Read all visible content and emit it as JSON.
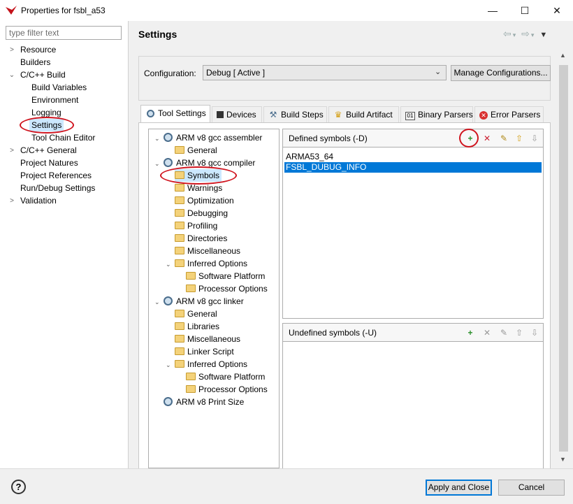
{
  "window": {
    "title": "Properties for fsbl_a53",
    "minimize": "—",
    "maximize": "☐",
    "close": "✕"
  },
  "filter": {
    "placeholder": "type filter text"
  },
  "nav": {
    "items": [
      {
        "label": "Resource"
      },
      {
        "label": "Builders"
      },
      {
        "label": "C/C++ Build"
      },
      {
        "label": "Build Variables"
      },
      {
        "label": "Environment"
      },
      {
        "label": "Logging"
      },
      {
        "label": "Settings"
      },
      {
        "label": "Tool Chain Editor"
      },
      {
        "label": "C/C++ General"
      },
      {
        "label": "Project Natures"
      },
      {
        "label": "Project References"
      },
      {
        "label": "Run/Debug Settings"
      },
      {
        "label": "Validation"
      }
    ]
  },
  "header": {
    "title": "Settings"
  },
  "config": {
    "label": "Configuration:",
    "value": "Debug  [ Active ]",
    "manage_label": "Manage Configurations..."
  },
  "tabs": [
    {
      "label": "Tool Settings",
      "icon": "gear-icon"
    },
    {
      "label": "Devices",
      "icon": "chip-icon"
    },
    {
      "label": "Build Steps",
      "icon": "build-steps-icon"
    },
    {
      "label": "Build Artifact",
      "icon": "trophy-icon"
    },
    {
      "label": "Binary Parsers",
      "icon": "binary-icon"
    },
    {
      "label": "Error Parsers",
      "icon": "error-icon"
    }
  ],
  "tooltree": [
    {
      "label": "ARM v8 gcc assembler"
    },
    {
      "label": "General"
    },
    {
      "label": "ARM v8 gcc compiler"
    },
    {
      "label": "Symbols"
    },
    {
      "label": "Warnings"
    },
    {
      "label": "Optimization"
    },
    {
      "label": "Debugging"
    },
    {
      "label": "Profiling"
    },
    {
      "label": "Directories"
    },
    {
      "label": "Miscellaneous"
    },
    {
      "label": "Inferred Options"
    },
    {
      "label": "Software Platform"
    },
    {
      "label": "Processor Options"
    },
    {
      "label": "ARM v8 gcc linker"
    },
    {
      "label": "General"
    },
    {
      "label": "Libraries"
    },
    {
      "label": "Miscellaneous"
    },
    {
      "label": "Linker Script"
    },
    {
      "label": "Inferred Options"
    },
    {
      "label": "Software Platform"
    },
    {
      "label": "Processor Options"
    },
    {
      "label": "ARM v8 Print Size"
    }
  ],
  "defined": {
    "title": "Defined symbols (-D)",
    "symbols": [
      "ARMA53_64",
      "FSBL_DUBUG_INFO"
    ]
  },
  "undefined": {
    "title": "Undefined symbols (-U)",
    "symbols": []
  },
  "buttons": {
    "help": "?",
    "apply": "Apply and Close",
    "cancel": "Cancel"
  },
  "colors": {
    "selection": "#0078d7",
    "highlight_circle": "#d0141e"
  }
}
